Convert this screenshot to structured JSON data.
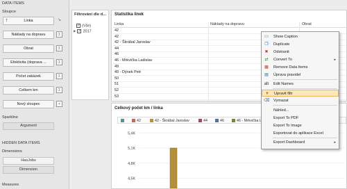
{
  "left": {
    "data_items_header": "DATA ITEMS",
    "columns_header": "Sloupce",
    "columns": [
      {
        "label": "Linka",
        "mini": "T"
      },
      {
        "label": "Náklady na dopravu",
        "mini": ""
      },
      {
        "label": "Obrat",
        "mini": ""
      },
      {
        "label": "Efektivita (doprava ...",
        "mini": ""
      },
      {
        "label": "Počet zakázek",
        "mini": ""
      },
      {
        "label": "Celkem km",
        "mini": ""
      }
    ],
    "new_column": "Nový sloupec",
    "sparkline_header": "Sparkline",
    "sparkline_button": "Argument",
    "hidden_header": "HIDDEN DATA ITEMS",
    "dimensions_header": "Dimensions",
    "dim_items": [
      "HasJobs",
      "Dimension"
    ],
    "measures_header": "Measures"
  },
  "filter": {
    "title": "Filtrování dle d...",
    "items": [
      {
        "label": "(Vše)",
        "checked": true
      },
      {
        "label": "2017",
        "checked": true
      }
    ]
  },
  "table": {
    "title": "Statistika linek",
    "headers": [
      "Linka",
      "Náklady na dopravu",
      "Obrat"
    ],
    "rows": [
      "42",
      "42",
      "42 - Škrábal Jaroslav",
      "44",
      "46",
      "46 - Mrkvička Ladislav",
      "49",
      "49 - Dýnek Petr",
      "50",
      "51",
      "52",
      "53"
    ]
  },
  "chart": {
    "title": "Celkový počet km / linka",
    "legend": [
      {
        "label": "",
        "color": "#5f8f98"
      },
      {
        "label": "42",
        "color": "#c0675f"
      },
      {
        "label": "42 - Škrábal Jaroslav",
        "color": "#b58f3a"
      },
      {
        "label": "44",
        "color": "#9c4a6b"
      },
      {
        "label": "46",
        "color": "#5a6f98"
      },
      {
        "label": "46 - Mrkvička Ladisla",
        "color": "#6b8a3e"
      }
    ],
    "yticks": [
      "5,4K",
      "5,1K",
      "4,8K",
      "4,5K"
    ]
  },
  "chart_data": {
    "type": "bar",
    "title": "Celkový počet km / linka",
    "categories": [
      "42 - Škrábal Jaroslav"
    ],
    "series": [
      {
        "name": "42 - Škrábal Jaroslav",
        "values": [
          5100
        ]
      }
    ],
    "ylim": [
      4300,
      5500
    ],
    "yticks": [
      "5,4K",
      "5,1K",
      "4,8K",
      "4,5K"
    ],
    "legend_placement": "top"
  },
  "context_menu": {
    "items": [
      {
        "label": "Show Caption",
        "icon": "caption-icon",
        "glyph": "▭",
        "submenu": false
      },
      {
        "label": "Duplicate",
        "icon": "duplicate-icon",
        "glyph": "❐",
        "submenu": false
      },
      {
        "label": "Odstranit",
        "icon": "delete-icon",
        "glyph": "✖",
        "submenu": false
      },
      {
        "label": "Convert To",
        "icon": "convert-icon",
        "glyph": "⇄",
        "submenu": true
      },
      {
        "label": "Remove Data Items",
        "icon": "remove-data-icon",
        "glyph": "▦",
        "submenu": false
      },
      {
        "label": "Úprava pravidel",
        "icon": "rules-icon",
        "glyph": "▤",
        "submenu": false
      },
      {
        "label": "Edit Names",
        "icon": "edit-names-icon",
        "glyph": "ab",
        "submenu": false
      },
      {
        "label": "Upravit filtr",
        "icon": "filter-icon",
        "glyph": "▼",
        "submenu": false
      },
      {
        "label": "Vymazat",
        "icon": "clear-icon",
        "glyph": "⌫",
        "submenu": false
      },
      {
        "label": "Náhled...",
        "icon": "",
        "glyph": "",
        "submenu": false
      },
      {
        "label": "Export To PDF",
        "icon": "",
        "glyph": "",
        "submenu": false
      },
      {
        "label": "Export To Image",
        "icon": "",
        "glyph": "",
        "submenu": false
      },
      {
        "label": "Exportovat do aplikace Excel",
        "icon": "",
        "glyph": "",
        "submenu": false
      },
      {
        "label": "Export Dashboard",
        "icon": "",
        "glyph": "",
        "submenu": true
      }
    ]
  }
}
